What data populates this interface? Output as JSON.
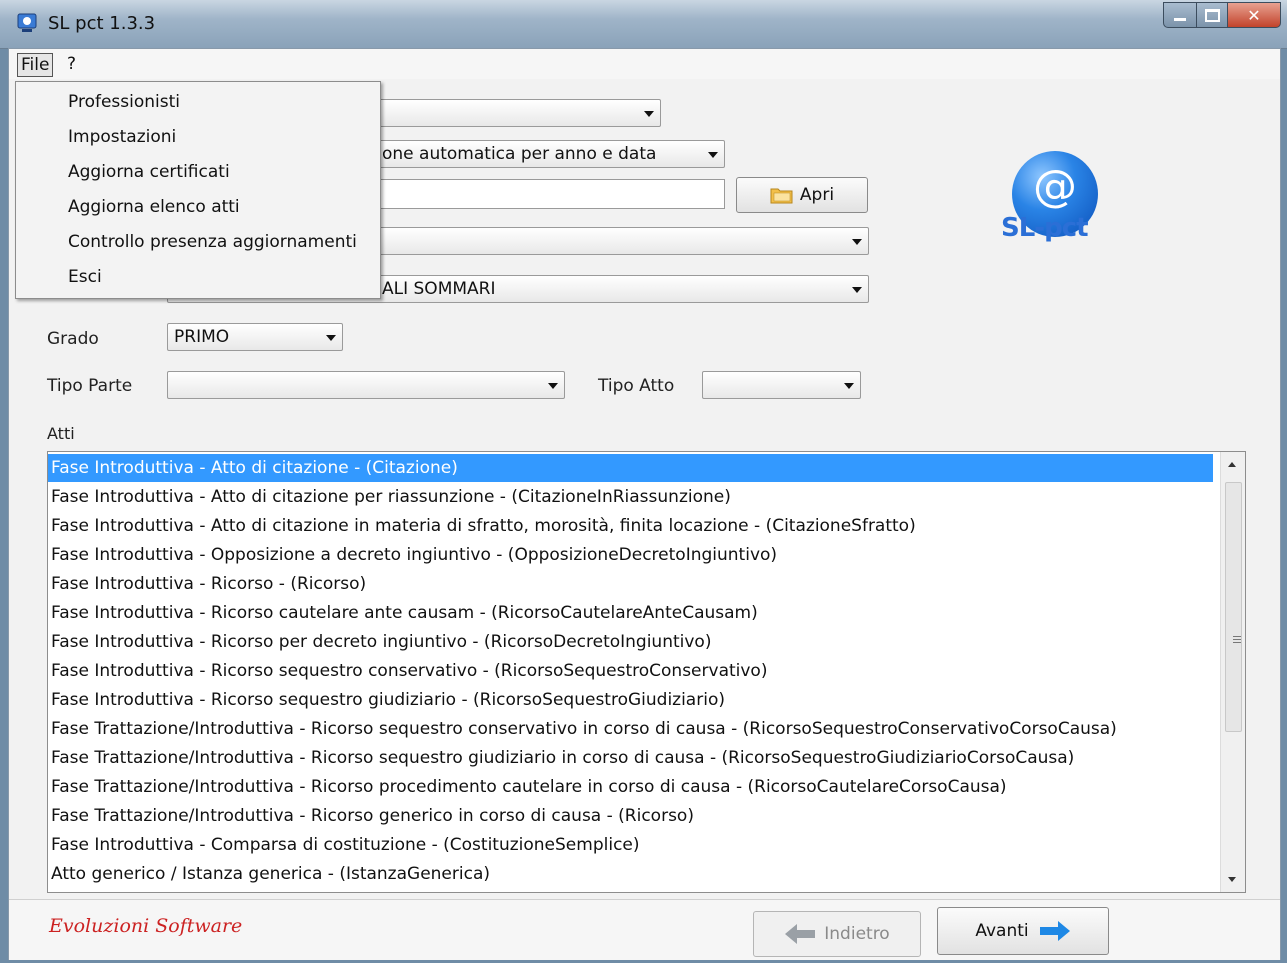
{
  "window": {
    "title": "SL pct 1.3.3"
  },
  "menubar": {
    "file": "File",
    "help": "?"
  },
  "file_menu": {
    "items": [
      "Professionisti",
      "Impostazioni",
      "Aggiorna certificati",
      "Aggiorna elenco atti",
      "Controllo presenza aggiornamenti",
      "Esci"
    ]
  },
  "form": {
    "combo1_value": "",
    "combo2_value": "one automatica per anno e data",
    "path_value": "",
    "open_button": "Apri",
    "combo3_value": "",
    "combo4_value": "ALI SOMMARI",
    "grado_label": "Grado",
    "grado_value": "PRIMO",
    "tipo_parte_label": "Tipo Parte",
    "tipo_parte_value": "",
    "tipo_atto_label": "Tipo Atto",
    "tipo_atto_value": "",
    "atti_label": "Atti"
  },
  "logo": {
    "symbol": "@",
    "text": "SL-pct"
  },
  "atti": [
    "Fase Introduttiva - Atto di citazione - (Citazione)",
    "Fase Introduttiva - Atto di citazione per riassunzione - (CitazioneInRiassunzione)",
    "Fase Introduttiva - Atto di citazione in materia di sfratto, morosità, finita locazione - (CitazioneSfratto)",
    "Fase Introduttiva - Opposizione a decreto ingiuntivo - (OpposizioneDecretoIngiuntivo)",
    "Fase Introduttiva - Ricorso - (Ricorso)",
    "Fase Introduttiva - Ricorso cautelare ante causam - (RicorsoCautelareAnteCausam)",
    "Fase Introduttiva - Ricorso per decreto ingiuntivo - (RicorsoDecretoIngiuntivo)",
    "Fase Introduttiva - Ricorso sequestro conservativo - (RicorsoSequestroConservativo)",
    "Fase Introduttiva - Ricorso sequestro giudiziario - (RicorsoSequestroGiudiziario)",
    "Fase Trattazione/Introduttiva - Ricorso sequestro conservativo in corso di causa - (RicorsoSequestroConservativoCorsoCausa)",
    "Fase Trattazione/Introduttiva - Ricorso sequestro giudiziario in corso di causa - (RicorsoSequestroGiudiziarioCorsoCausa)",
    "Fase Trattazione/Introduttiva - Ricorso procedimento cautelare in corso di causa - (RicorsoCautelareCorsoCausa)",
    "Fase Trattazione/Introduttiva - Ricorso generico in corso di causa - (Ricorso)",
    "Fase Introduttiva - Comparsa di costituzione - (CostituzioneSemplice)",
    "Atto generico / Istanza generica - (IstanzaGenerica)"
  ],
  "selected_index": 0,
  "footer": {
    "brand": "Evoluzioni Software",
    "back": "Indietro",
    "next": "Avanti"
  },
  "colors": {
    "selection": "#3399ff",
    "arrow_blue": "#1e88e5",
    "brand_red": "#cc2222"
  }
}
